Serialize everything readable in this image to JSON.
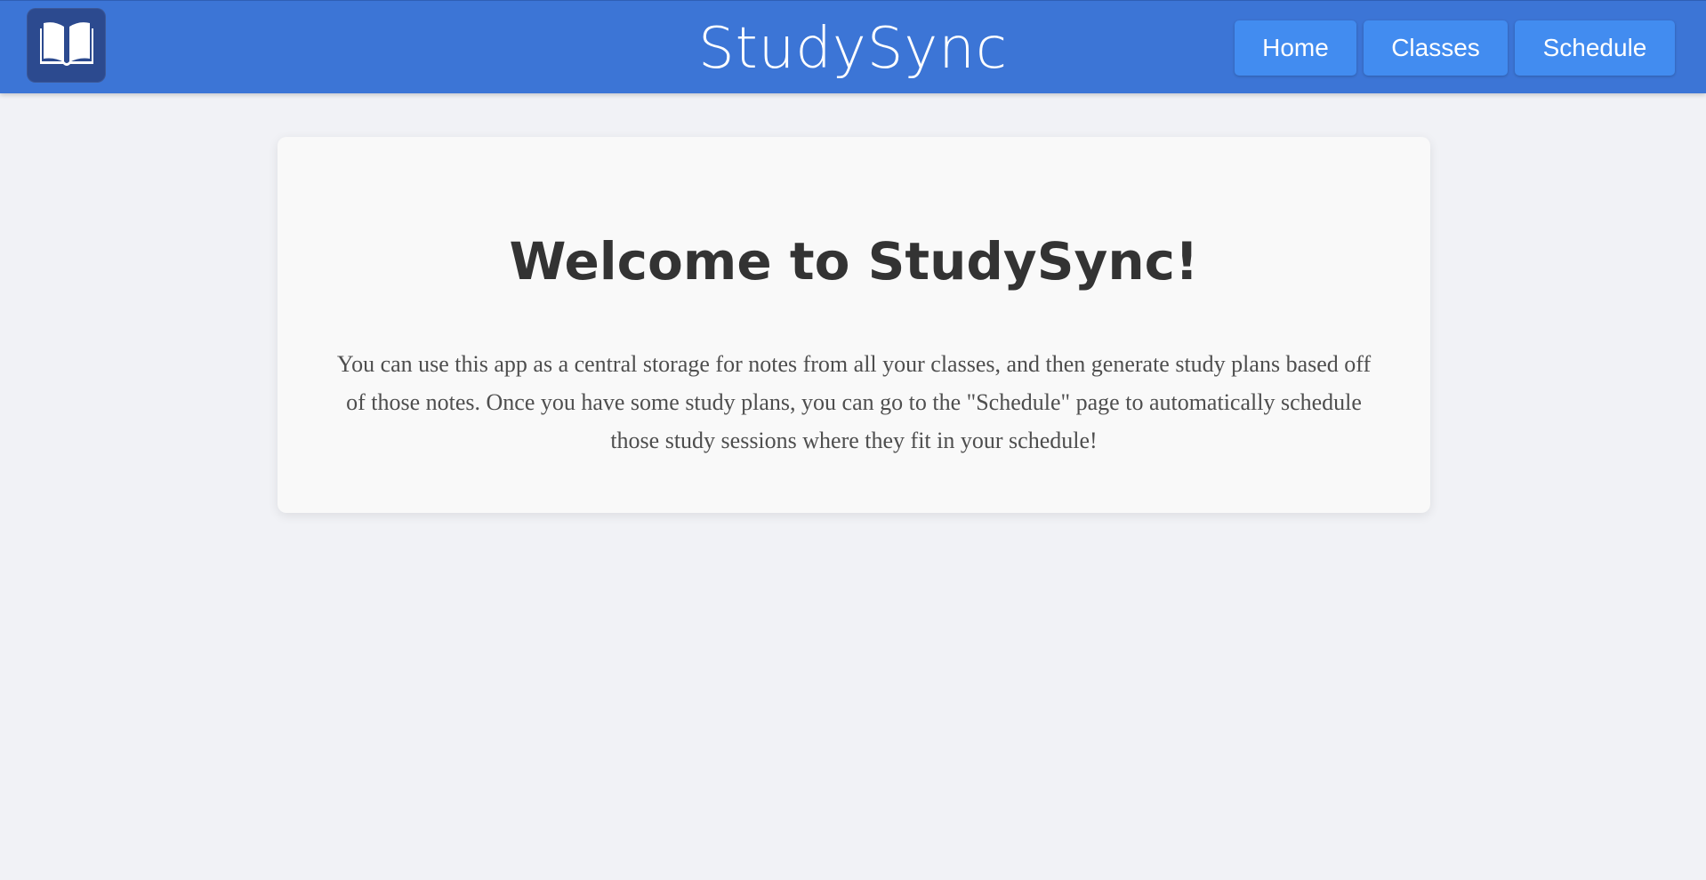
{
  "header": {
    "logo_icon": "open-book-icon",
    "title": "StudySync",
    "nav": [
      {
        "label": "Home"
      },
      {
        "label": "Classes"
      },
      {
        "label": "Schedule"
      }
    ]
  },
  "main": {
    "heading": "Welcome to StudySync!",
    "description": "You can use this app as a central storage for notes from all your classes, and then generate study plans based off of those notes. Once you have some study plans, you can go to the \"Schedule\" page to automatically schedule those study sessions where they fit in your schedule!"
  },
  "colors": {
    "header_bg": "#3c75d6",
    "logo_bg": "#2c4a8f",
    "nav_button_bg": "#428cf0",
    "page_bg": "#f1f2f6",
    "card_bg": "#f9f9f9",
    "heading_text": "#333333",
    "body_text": "#4e4e4e"
  }
}
